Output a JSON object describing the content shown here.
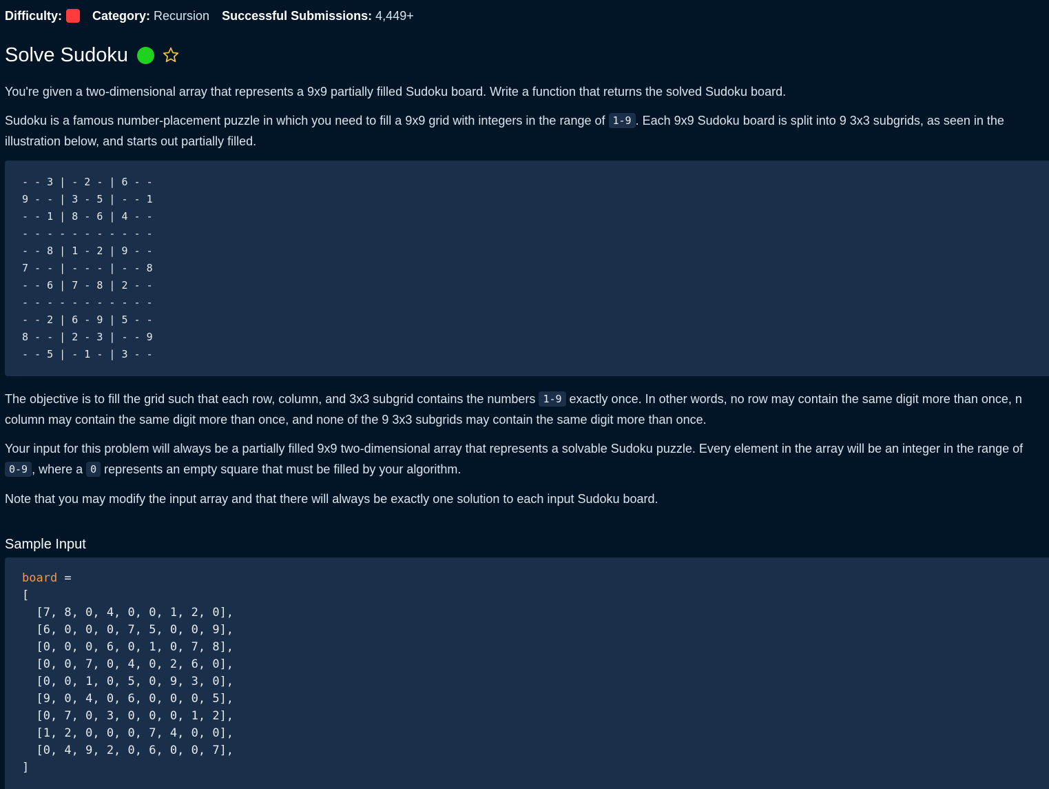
{
  "meta": {
    "difficulty_label": "Difficulty:",
    "difficulty_color": "#ff3b3b",
    "category_label": "Category:",
    "category_value": "Recursion",
    "submissions_label": "Successful Submissions:",
    "submissions_value": "4,449+"
  },
  "problem": {
    "title": "Solve Sudoku",
    "status_color": "#1ed21e",
    "star_icon": "star-outline-icon",
    "star_color": "#f5c242"
  },
  "description": {
    "p1": "You're given a two-dimensional array that represents a 9x9 partially filled Sudoku board. Write a function that returns the solved Sudoku board.",
    "p2_a": "Sudoku is a famous number-placement puzzle in which you need to fill a 9x9 grid with integers in the range of ",
    "p2_code": "1-9",
    "p2_b": ". Each 9x9 Sudoku board is split into 9 3x3 subgrids, as seen in the",
    "p2_c": "illustration below, and starts out partially filled.",
    "grid_lines": [
      "- - 3 | - 2 - | 6 - -",
      "9 - - | 3 - 5 | - - 1",
      "- - 1 | 8 - 6 | 4 - -",
      "- - - - - - - - - - -",
      "- - 8 | 1 - 2 | 9 - -",
      "7 - - | - - - | - - 8",
      "- - 6 | 7 - 8 | 2 - -",
      "- - - - - - - - - - -",
      "- - 2 | 6 - 9 | 5 - -",
      "8 - - | 2 - 3 | - - 9",
      "- - 5 | - 1 - | 3 - -"
    ],
    "p3_a": "The objective is to fill the grid such that each row, column, and 3x3 subgrid contains the numbers ",
    "p3_code": "1-9",
    "p3_b": " exactly once. In other words, no row may contain the same digit more than once, n",
    "p3_c": "column may contain the same digit more than once, and none of the 9 3x3 subgrids may contain the same digit more than once.",
    "p4_a": "Your input for this problem will always be a partially filled 9x9 two-dimensional array that represents a solvable Sudoku puzzle. Every element in the array will be an integer in the range of",
    "p4_code1": "0-9",
    "p4_b": ", where a ",
    "p4_code2": "0",
    "p4_c": " represents an empty square that must be filled by your algorithm.",
    "p5": "Note that you may modify the input array and that there will always be exactly one solution to each input Sudoku board."
  },
  "sample_input": {
    "heading": "Sample Input",
    "var_name": "board",
    "assign": " =",
    "open": "[",
    "rows": [
      "  [7, 8, 0, 4, 0, 0, 1, 2, 0],",
      "  [6, 0, 0, 0, 7, 5, 0, 0, 9],",
      "  [0, 0, 0, 6, 0, 1, 0, 7, 8],",
      "  [0, 0, 7, 0, 4, 0, 2, 6, 0],",
      "  [0, 0, 1, 0, 5, 0, 9, 3, 0],",
      "  [9, 0, 4, 0, 6, 0, 0, 0, 5],",
      "  [0, 7, 0, 3, 0, 0, 0, 1, 2],",
      "  [1, 2, 0, 0, 0, 7, 4, 0, 0],",
      "  [0, 4, 9, 2, 0, 6, 0, 0, 7],"
    ],
    "close": "]"
  }
}
